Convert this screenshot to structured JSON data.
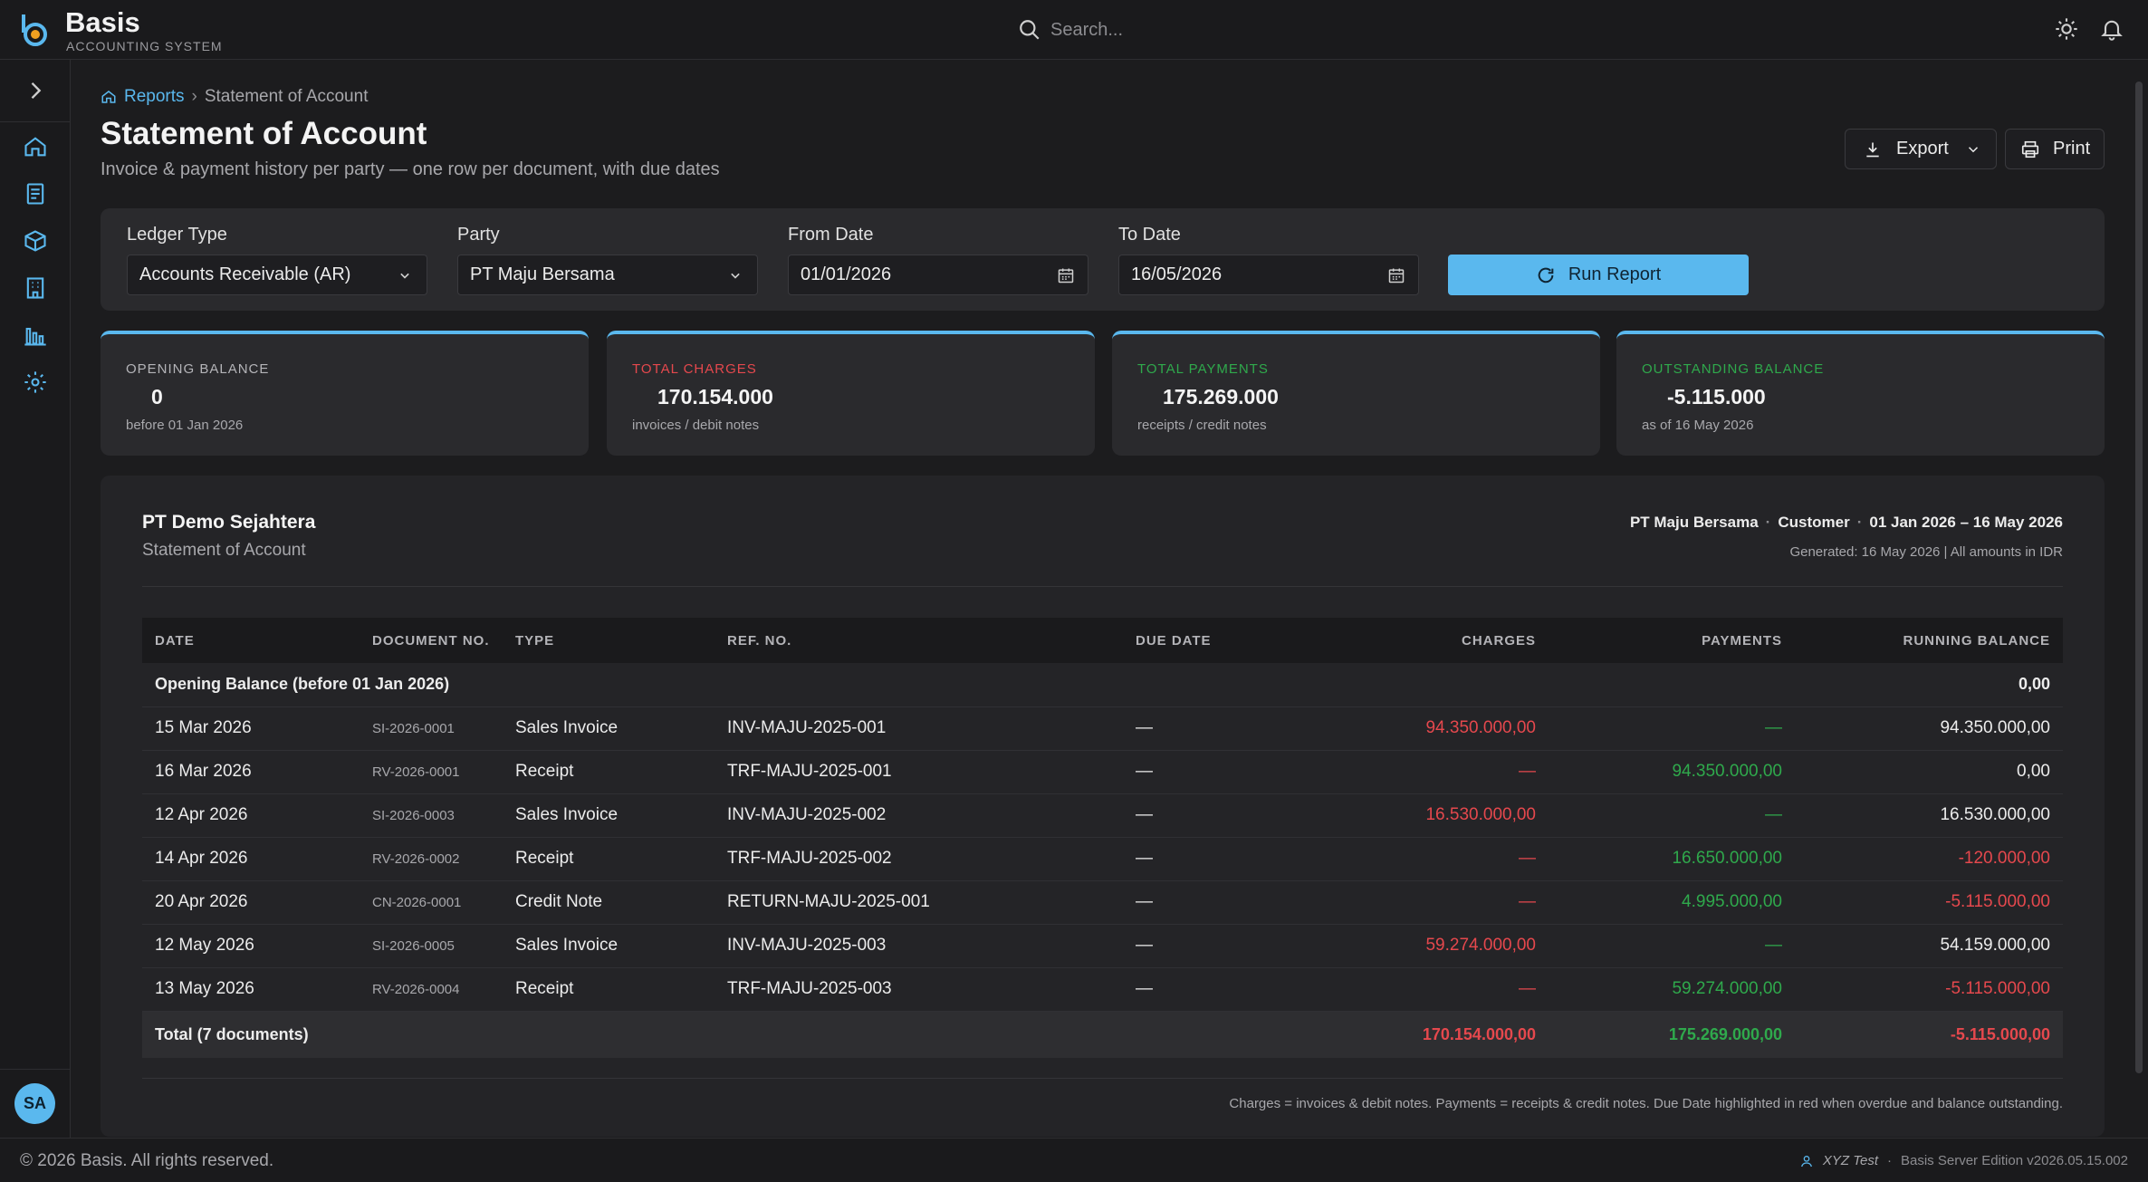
{
  "brand": {
    "name": "Basis",
    "subtitle": "ACCOUNTING SYSTEM"
  },
  "search": {
    "placeholder": "Search..."
  },
  "colors": {
    "accent": "#5ab8ee",
    "negative": "#e5484d",
    "positive": "#2fa94c",
    "background": "#1c1c1e"
  },
  "sidebar": {
    "items": [
      {
        "icon": "chevron-right-icon"
      },
      {
        "icon": "home-icon"
      },
      {
        "icon": "document-icon"
      },
      {
        "icon": "box-icon"
      },
      {
        "icon": "building-icon"
      },
      {
        "icon": "bar-chart-icon"
      },
      {
        "icon": "gear-icon"
      }
    ],
    "avatar": "SA"
  },
  "breadcrumb": {
    "link": "Reports",
    "separator": "›",
    "current": "Statement of Account"
  },
  "page": {
    "title": "Statement of Account",
    "subtitle": "Invoice & payment history per party — one row per document, with due dates"
  },
  "toolbar": {
    "export_label": "Export",
    "print_label": "Print"
  },
  "filters": {
    "ledger_type": {
      "label": "Ledger Type",
      "value": "Accounts Receivable (AR)"
    },
    "party": {
      "label": "Party",
      "value": "PT Maju Bersama"
    },
    "from_date": {
      "label": "From Date",
      "value": "01/01/2026"
    },
    "to_date": {
      "label": "To Date",
      "value": "16/05/2026"
    },
    "run_label": "Run Report"
  },
  "cards": [
    {
      "label": "OPENING BALANCE",
      "value": "0",
      "note": "before 01 Jan 2026",
      "color": "#b4b4b8"
    },
    {
      "label": "TOTAL CHARGES",
      "value": "170.154.000",
      "note": "invoices / debit notes",
      "color": "#e5484d"
    },
    {
      "label": "TOTAL PAYMENTS",
      "value": "175.269.000",
      "note": "receipts / credit notes",
      "color": "#2fa94c"
    },
    {
      "label": "OUTSTANDING BALANCE",
      "value": "-5.115.000",
      "note": "as of 16 May 2026",
      "color": "#2fa94c"
    }
  ],
  "report": {
    "company": "PT Demo Sejahtera",
    "name": "Statement of Account",
    "meta": {
      "party": "PT Maju Bersama",
      "party_type": "Customer",
      "period": "01 Jan 2026 – 16 May 2026",
      "separator": "·"
    },
    "generated": "Generated: 16 May 2026 | All amounts in IDR",
    "columns": [
      "DATE",
      "DOCUMENT NO.",
      "TYPE",
      "REF. NO.",
      "DUE DATE",
      "CHARGES",
      "PAYMENTS",
      "RUNNING BALANCE"
    ],
    "opening": {
      "label": "Opening Balance (before 01 Jan 2026)",
      "balance": "0,00"
    },
    "rows": [
      {
        "date": "15 Mar 2026",
        "doc": "SI-2026-0001",
        "type": "Sales Invoice",
        "ref": "INV-MAJU-2025-001",
        "due": "—",
        "charges": "94.350.000,00",
        "payments": "—",
        "balance": "94.350.000,00",
        "neg": false
      },
      {
        "date": "16 Mar 2026",
        "doc": "RV-2026-0001",
        "type": "Receipt",
        "ref": "TRF-MAJU-2025-001",
        "due": "—",
        "charges": "—",
        "payments": "94.350.000,00",
        "balance": "0,00",
        "neg": false
      },
      {
        "date": "12 Apr 2026",
        "doc": "SI-2026-0003",
        "type": "Sales Invoice",
        "ref": "INV-MAJU-2025-002",
        "due": "—",
        "charges": "16.530.000,00",
        "payments": "—",
        "balance": "16.530.000,00",
        "neg": false
      },
      {
        "date": "14 Apr 2026",
        "doc": "RV-2026-0002",
        "type": "Receipt",
        "ref": "TRF-MAJU-2025-002",
        "due": "—",
        "charges": "—",
        "payments": "16.650.000,00",
        "balance": "-120.000,00",
        "neg": true
      },
      {
        "date": "20 Apr 2026",
        "doc": "CN-2026-0001",
        "type": "Credit Note",
        "ref": "RETURN-MAJU-2025-001",
        "due": "—",
        "charges": "—",
        "payments": "4.995.000,00",
        "balance": "-5.115.000,00",
        "neg": true
      },
      {
        "date": "12 May 2026",
        "doc": "SI-2026-0005",
        "type": "Sales Invoice",
        "ref": "INV-MAJU-2025-003",
        "due": "—",
        "charges": "59.274.000,00",
        "payments": "—",
        "balance": "54.159.000,00",
        "neg": false
      },
      {
        "date": "13 May 2026",
        "doc": "RV-2026-0004",
        "type": "Receipt",
        "ref": "TRF-MAJU-2025-003",
        "due": "—",
        "charges": "—",
        "payments": "59.274.000,00",
        "balance": "-5.115.000,00",
        "neg": true
      }
    ],
    "total": {
      "label": "Total (7 documents)",
      "charges": "170.154.000,00",
      "payments": "175.269.000,00",
      "balance": "-5.115.000,00"
    },
    "footnote": "Charges = invoices & debit notes. Payments = receipts & credit notes. Due Date highlighted in red when overdue and balance outstanding."
  },
  "footer": {
    "copyright": "© 2026 Basis. All rights reserved.",
    "user": "XYZ Test",
    "separator": "·",
    "edition": "Basis Server Edition v2026.05.15.002"
  }
}
